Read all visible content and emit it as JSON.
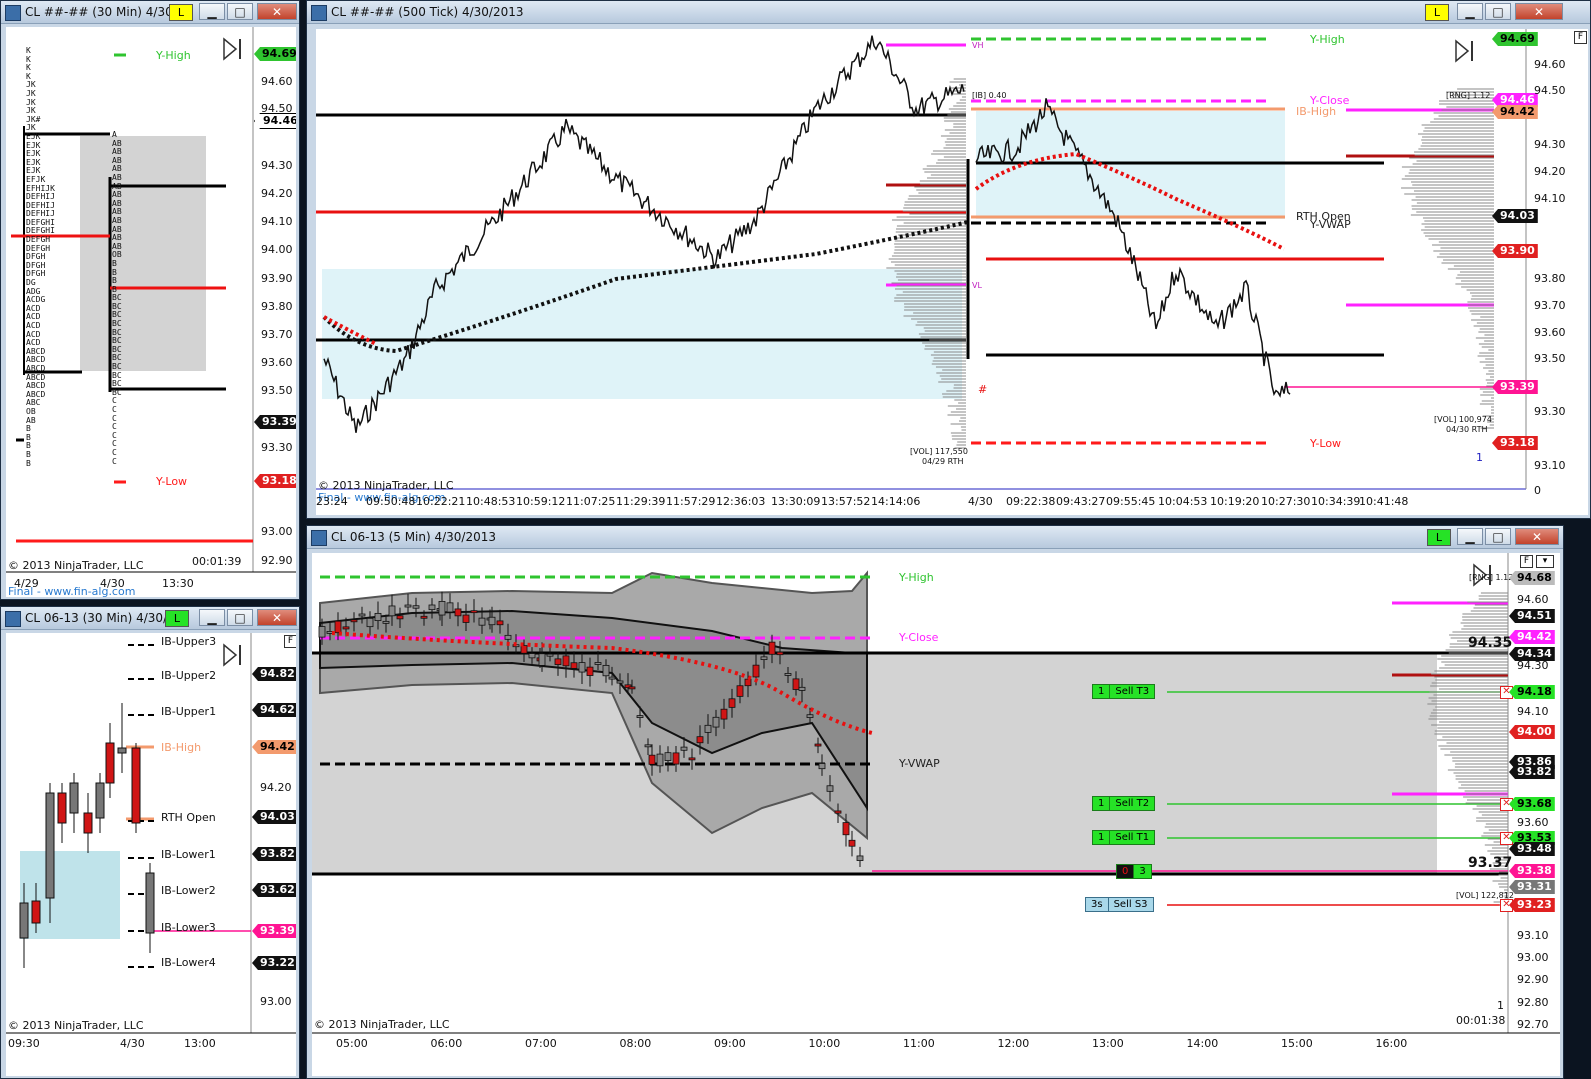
{
  "windows": {
    "tpo": {
      "title": "CL ##-## (30 Min)  4/30/2",
      "badge": "L",
      "badge_color": "#ffff00",
      "yhigh": "Y-High",
      "ylow": "Y-Low",
      "prices": [
        "94.60",
        "94.50",
        "94.30",
        "94.20",
        "94.10",
        "94.00",
        "93.90",
        "93.80",
        "93.70",
        "93.60",
        "93.50",
        "93.30",
        "93.00",
        "92.90"
      ],
      "badges": {
        "high": "94.69",
        "last": "94.46",
        "p1": "93.39",
        "low": "93.18"
      },
      "time_labels": [
        "4/29",
        "4/30",
        "13:30"
      ],
      "timer": "00:01:39",
      "copyright": "© 2013 NinjaTrader, LLC",
      "footer": "Final - www.fin-alg.com",
      "letters_left": "K\nK\nK\nK\nJK\nJK\nJK\nJK\nJK#\nJK\nEJK\nEJK\nEJK\nEJK\nEJK\nEFJK\nEFHIJK\nDEFHIJ\nDEFHIJ\nDEFHIJ\nDEFGHI\nDEFGHI\nDEFGH\nDEFGH\nDFGH\nDFGH\nDFGH\nDG\nADG\nACDG\nACD\nACD\nACD\nACD\nACD\nABCD\nABCD\nABCD\nABCD\nABCD\nABCD\nABC\nOB\nAB\nB\nB\nB\nB\nB",
      "letters_right": "A\nAB\nAB\nAB\nAB\nAB\nAB\nAB\nAB\nAB\nAB\nAB\nAB\nAB\nOB\nB\nB\nB\nB\nBC\nBC\nBC\nBC\nBC\nBC\nBC\nBC\nBC\nBC\nBC\nBC\nC\nC\nC\nC\nC\nC\nC\nC"
    },
    "tick": {
      "title": "CL ##-## (500 Tick)  4/30/2013",
      "badge": "L",
      "labels": {
        "yhigh": "Y-High",
        "yclose": "Y-Close",
        "ibhigh": "IB-High",
        "rthopen": "RTH Open",
        "yvwap": "Y-VWAP",
        "ylow": "Y-Low",
        "vh": "VH",
        "vl": "VL"
      },
      "notes": {
        "ib": "[IB] 0.40",
        "rng": "[RNG] 1.12",
        "vol_left": "[VOL] 117,550",
        "vol_left_date": "04/29 RTH",
        "vol_right": "[VOL] 100,974",
        "vol_right_date": "04/30 RTH",
        "one": "1",
        "zero": "0"
      },
      "prices": [
        "94.60",
        "94.50",
        "94.30",
        "94.20",
        "94.10",
        "93.80",
        "93.70",
        "93.60",
        "93.50",
        "93.30",
        "93.10"
      ],
      "badges": {
        "high": "94.69",
        "yclose": "94.46",
        "ibhigh": "94.42",
        "last": "94.03",
        "p1": "93.90",
        "p2": "93.39",
        "low": "93.18"
      },
      "time_labels": [
        "23:24",
        "09:50:48",
        "10:22:21",
        "10:48:53",
        "10:59:12",
        "11:07:25",
        "11:29:39",
        "11:57:29",
        "12:36:03",
        "13:30:09",
        "13:57:52",
        "14:14:06",
        "4/30",
        "09:22:38",
        "09:43:27",
        "09:55:45",
        "10:04:53",
        "10:19:20",
        "10:27:30",
        "10:34:39",
        "10:41:48"
      ],
      "copyright": "© 2013 NinjaTrader, LLC",
      "footer": "Final - www.fin-alg.com"
    },
    "ib": {
      "title": "CL 06-13 (30 Min)  4/30/2",
      "badge": "L",
      "badge_color": "#26e226",
      "levels": [
        "IB-Upper3",
        "IB-Upper2",
        "IB-Upper1",
        "IB-High",
        "RTH Open",
        "IB-Lower1",
        "IB-Lower2",
        "IB-Lower3",
        "IB-Lower4"
      ],
      "prices": [
        "94.20",
        "93.00"
      ],
      "badges": [
        "94.82",
        "94.62",
        "94.42",
        "94.03",
        "93.82",
        "93.62",
        "93.39",
        "93.22"
      ],
      "time_labels": [
        "09:30",
        "4/30",
        "13:00"
      ],
      "copyright": "© 2013 NinjaTrader, LLC"
    },
    "five": {
      "title": "CL 06-13 (5 Min)  4/30/2013",
      "badge": "L",
      "labels": {
        "yhigh": "Y-High",
        "yclose": "Y-Close",
        "yvwap": "Y-VWAP",
        "big1": "94.35",
        "big2": "93.37",
        "rng": "[RNG] 1.12",
        "vol": "[VOL] 122,812",
        "one": "1"
      },
      "orders": [
        {
          "qty": "1",
          "label": "Sell T3",
          "price": "94.18"
        },
        {
          "qty": "1",
          "label": "Sell T2",
          "price": "93.68"
        },
        {
          "qty": "1",
          "label": "Sell T1",
          "price": "93.53"
        },
        {
          "qty": "3s",
          "label": "Sell S3",
          "price": "93.23"
        }
      ],
      "position": {
        "pnl": "0",
        "qty": "3"
      },
      "prices": [
        "94.60",
        "94.30",
        "94.10",
        "93.60",
        "93.10",
        "93.00",
        "92.90",
        "92.80",
        "92.70"
      ],
      "badges": {
        "top": "94.68",
        "b1": "94.51",
        "b2": "94.42",
        "b3": "94.34",
        "b4": "94.18",
        "b5": "94.00",
        "b6": "93.86",
        "b7": "93.82",
        "b8": "93.68",
        "b9": "93.53",
        "b10": "93.48",
        "b11": "93.38",
        "b12": "93.31",
        "b13": "93.23"
      },
      "time_labels": [
        "05:00",
        "06:00",
        "07:00",
        "08:00",
        "09:00",
        "10:00",
        "11:00",
        "12:00",
        "13:00",
        "14:00",
        "15:00",
        "16:00"
      ],
      "timer": "00:01:38",
      "copyright": "© 2013 NinjaTrader, LLC"
    }
  },
  "colors": {
    "green": "#2fc42f",
    "magenta": "#ff22ff",
    "red": "#ff1a1a",
    "orange": "#f4a070",
    "black": "#000000",
    "salmon": "#f39a6d",
    "pink": "#ff1493",
    "lightblue": "#dff3f8",
    "gray": "#d3d3d3"
  }
}
